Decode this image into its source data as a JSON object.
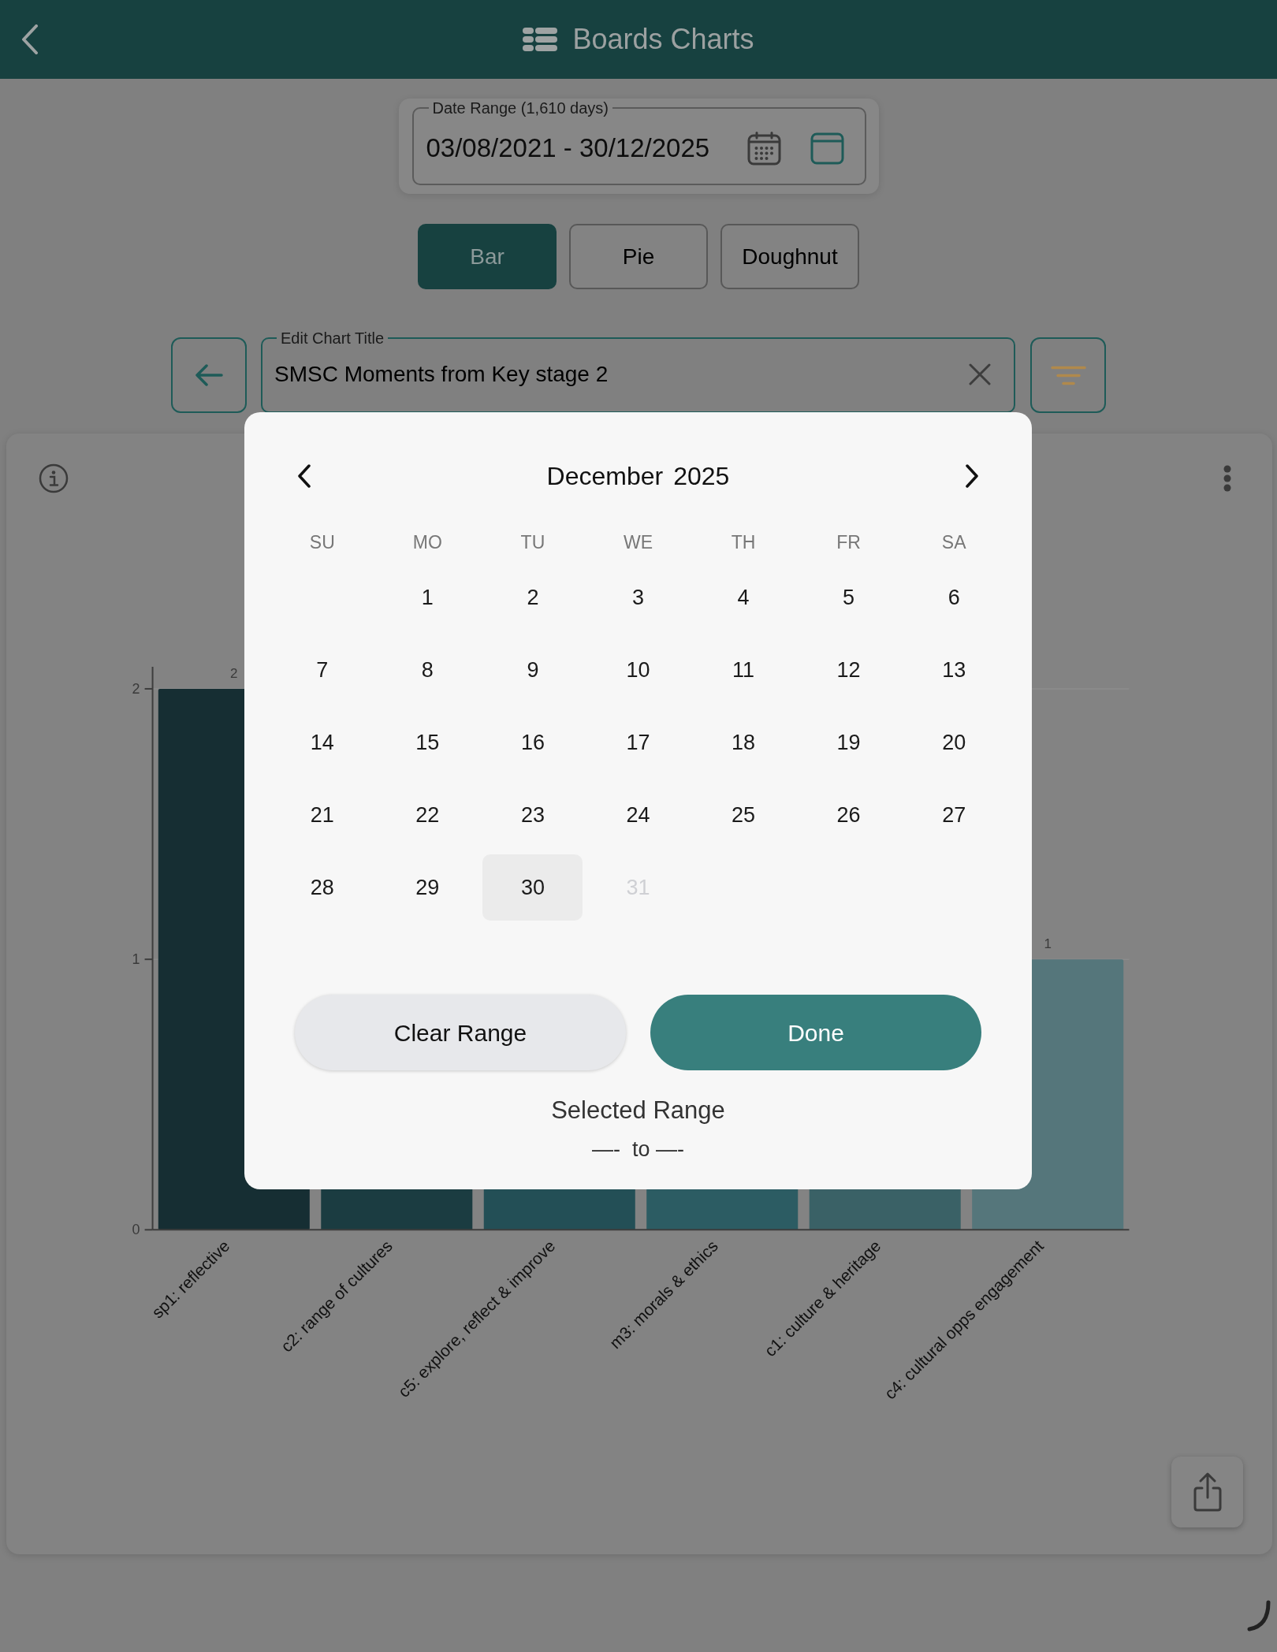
{
  "header": {
    "title": "Boards Charts"
  },
  "date_range": {
    "label": "Date Range (1,610 days)",
    "value": "03/08/2021 - 30/12/2025"
  },
  "chart_types": [
    {
      "label": "Bar",
      "selected": true
    },
    {
      "label": "Pie",
      "selected": false
    },
    {
      "label": "Doughnut",
      "selected": false
    }
  ],
  "chart_title_field": {
    "label": "Edit Chart Title",
    "value": "SMSC Moments from Key stage 2"
  },
  "chart": {
    "chart_data": {
      "type": "bar",
      "categories": [
        "sp1: reflective",
        "c2: range of cultures",
        "c5: explore, reflect & improve",
        "m3: morals & ethics",
        "c1: culture & heritage",
        "c4: cultural opps engagement"
      ],
      "series": [
        {
          "colors": [
            "#162e33",
            "#1b3c41",
            "#234f56",
            "#2c5c63",
            "#3a6166",
            "#55767b"
          ],
          "values": [
            2,
            null,
            null,
            null,
            null,
            1
          ]
        }
      ],
      "ylim": [
        0,
        2
      ],
      "yticks": [
        0,
        1,
        2
      ],
      "data_labels": true
    }
  },
  "date_picker": {
    "month": "December",
    "year": "2025",
    "weekdays": [
      "SU",
      "MO",
      "TU",
      "WE",
      "TH",
      "FR",
      "SA"
    ],
    "weeks": [
      [
        {
          "label": "1",
          "selected": false,
          "disabled": false
        },
        {
          "label": "2",
          "selected": false,
          "disabled": false
        },
        {
          "label": "3",
          "selected": false,
          "disabled": false
        },
        {
          "label": "4",
          "selected": false,
          "disabled": false
        },
        {
          "label": "5",
          "selected": false,
          "disabled": false
        },
        {
          "label": "6",
          "selected": false,
          "disabled": false
        }
      ],
      [
        {
          "label": "7",
          "selected": false,
          "disabled": false
        },
        {
          "label": "8",
          "selected": false,
          "disabled": false
        },
        {
          "label": "9",
          "selected": false,
          "disabled": false
        },
        {
          "label": "10",
          "selected": false,
          "disabled": false
        },
        {
          "label": "11",
          "selected": false,
          "disabled": false
        },
        {
          "label": "12",
          "selected": false,
          "disabled": false
        },
        {
          "label": "13",
          "selected": false,
          "disabled": false
        }
      ],
      [
        {
          "label": "14",
          "selected": false,
          "disabled": false
        },
        {
          "label": "15",
          "selected": false,
          "disabled": false
        },
        {
          "label": "16",
          "selected": false,
          "disabled": false
        },
        {
          "label": "17",
          "selected": false,
          "disabled": false
        },
        {
          "label": "18",
          "selected": false,
          "disabled": false
        },
        {
          "label": "19",
          "selected": false,
          "disabled": false
        },
        {
          "label": "20",
          "selected": false,
          "disabled": false
        }
      ],
      [
        {
          "label": "21",
          "selected": false,
          "disabled": false
        },
        {
          "label": "22",
          "selected": false,
          "disabled": false
        },
        {
          "label": "23",
          "selected": false,
          "disabled": false
        },
        {
          "label": "24",
          "selected": false,
          "disabled": false
        },
        {
          "label": "25",
          "selected": false,
          "disabled": false
        },
        {
          "label": "26",
          "selected": false,
          "disabled": false
        },
        {
          "label": "27",
          "selected": false,
          "disabled": false
        }
      ],
      [
        {
          "label": "28",
          "selected": false,
          "disabled": false
        },
        {
          "label": "29",
          "selected": false,
          "disabled": false
        },
        {
          "label": "30",
          "selected": true,
          "disabled": false
        },
        {
          "label": "31",
          "selected": false,
          "disabled": true
        }
      ]
    ],
    "buttons": [
      {
        "label": "Clear Range",
        "kind": "secondary"
      },
      {
        "label": "Done",
        "kind": "primary"
      }
    ],
    "selected_range": {
      "label": "Selected Range",
      "value": "—-  to —-"
    }
  }
}
